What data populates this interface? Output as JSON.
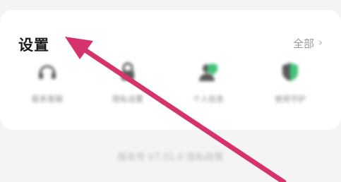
{
  "settings": {
    "title": "设置",
    "all_label": "全部",
    "chevron": "›",
    "items": [
      {
        "label": "联系客服",
        "icon": "headset-icon"
      },
      {
        "label": "隐私设置",
        "icon": "lock-icon"
      },
      {
        "label": "个人信息",
        "icon": "person-shield-icon"
      },
      {
        "label": "使用守护",
        "icon": "shield-check-icon"
      }
    ]
  },
  "footer_text": "版本号 V7.01.0 隐私政策",
  "colors": {
    "arrow": "#d6336c",
    "accent_green": "#43c47a"
  }
}
